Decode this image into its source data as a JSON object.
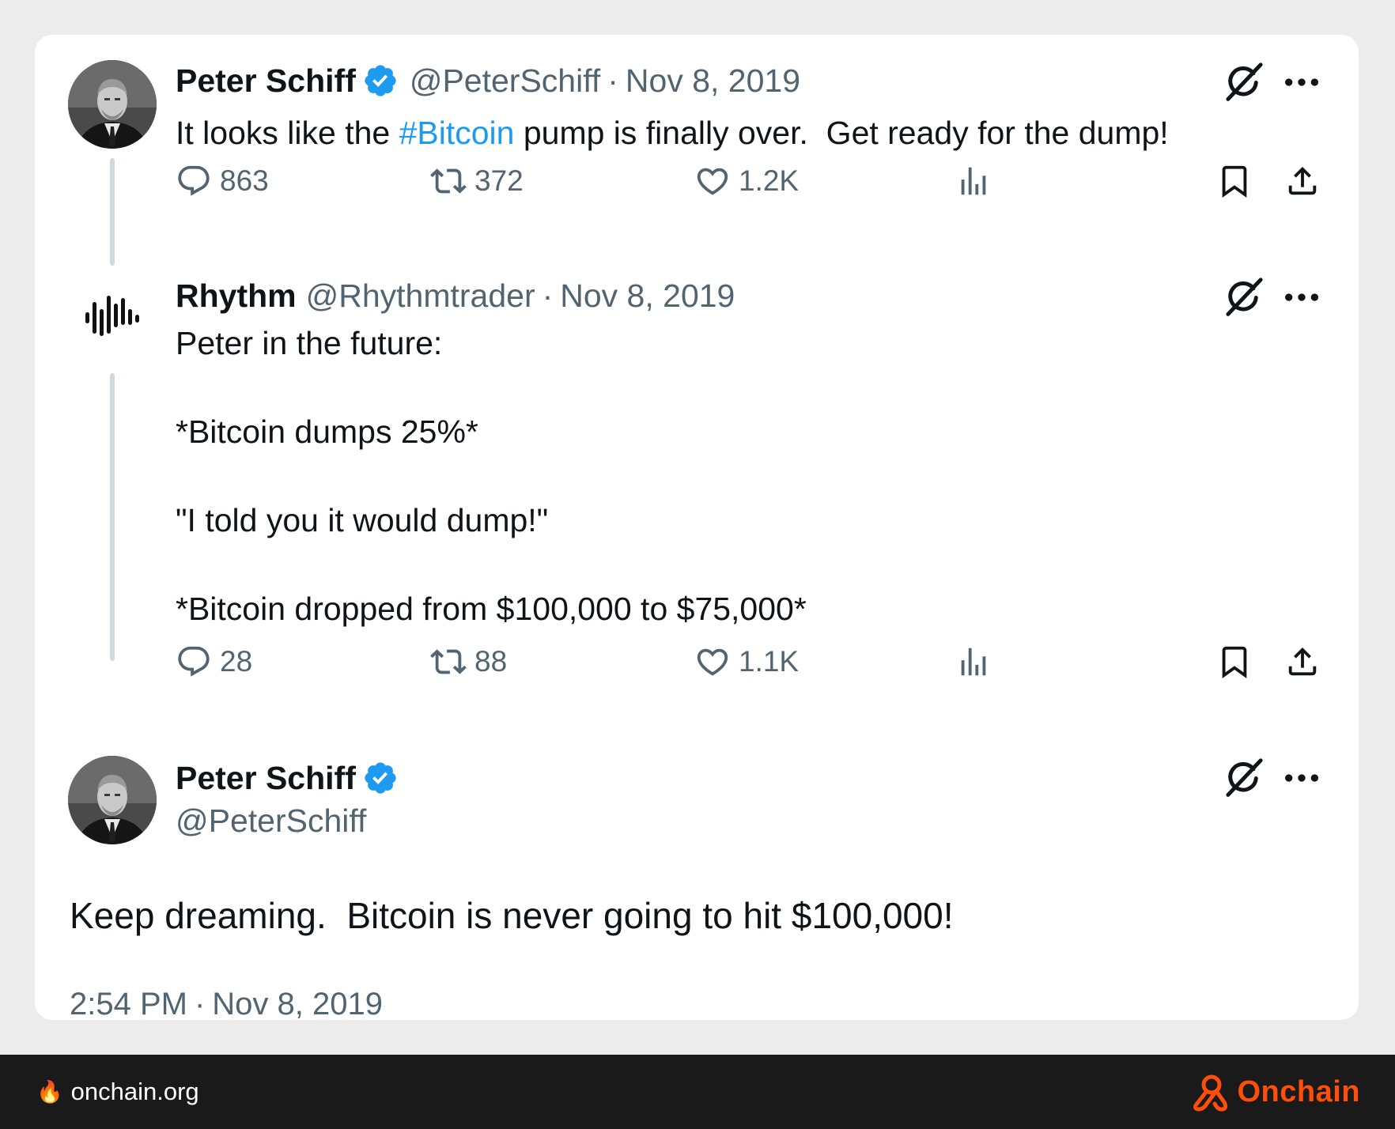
{
  "tweet1": {
    "name": "Peter Schiff",
    "handle": "@PeterSchiff",
    "separator": "·",
    "date": "Nov 8, 2019",
    "text_before": "It looks like the ",
    "hashtag": "#Bitcoin",
    "text_after": " pump is finally over.  Get ready for the dump!",
    "replies": "863",
    "retweets": "372",
    "likes": "1.2K"
  },
  "tweet2": {
    "name": "Rhythm",
    "handle": "@Rhythmtrader",
    "separator": "·",
    "date": "Nov 8, 2019",
    "lines": [
      "Peter in the future:",
      "*Bitcoin dumps 25%*",
      "\"I told you it would dump!\"",
      "*Bitcoin dropped from $100,000 to $75,000*"
    ],
    "replies": "28",
    "retweets": "88",
    "likes": "1.1K"
  },
  "tweet3": {
    "name": "Peter Schiff",
    "handle": "@PeterSchiff",
    "text": "Keep dreaming.  Bitcoin is never going to hit $100,000!",
    "timestamp": "2:54 PM",
    "separator": "·",
    "date": "Nov 8, 2019"
  },
  "footer": {
    "site": "onchain.org",
    "brand": "Onchain"
  },
  "colors": {
    "accent_blue": "#1d9bf0",
    "muted_text": "#536471",
    "brand_orange": "#ff4d0a",
    "footer_bg": "#1a1a1a",
    "page_bg": "#ececec"
  },
  "icons": {
    "reply": "speech-bubble-icon",
    "retweet": "retweet-icon",
    "like": "heart-icon",
    "views": "bar-chart-icon",
    "bookmark": "bookmark-icon",
    "share": "share-icon",
    "grok": "grok-icon",
    "more": "more-dots-icon",
    "verified": "verified-badge-icon",
    "fire": "fire-icon"
  }
}
